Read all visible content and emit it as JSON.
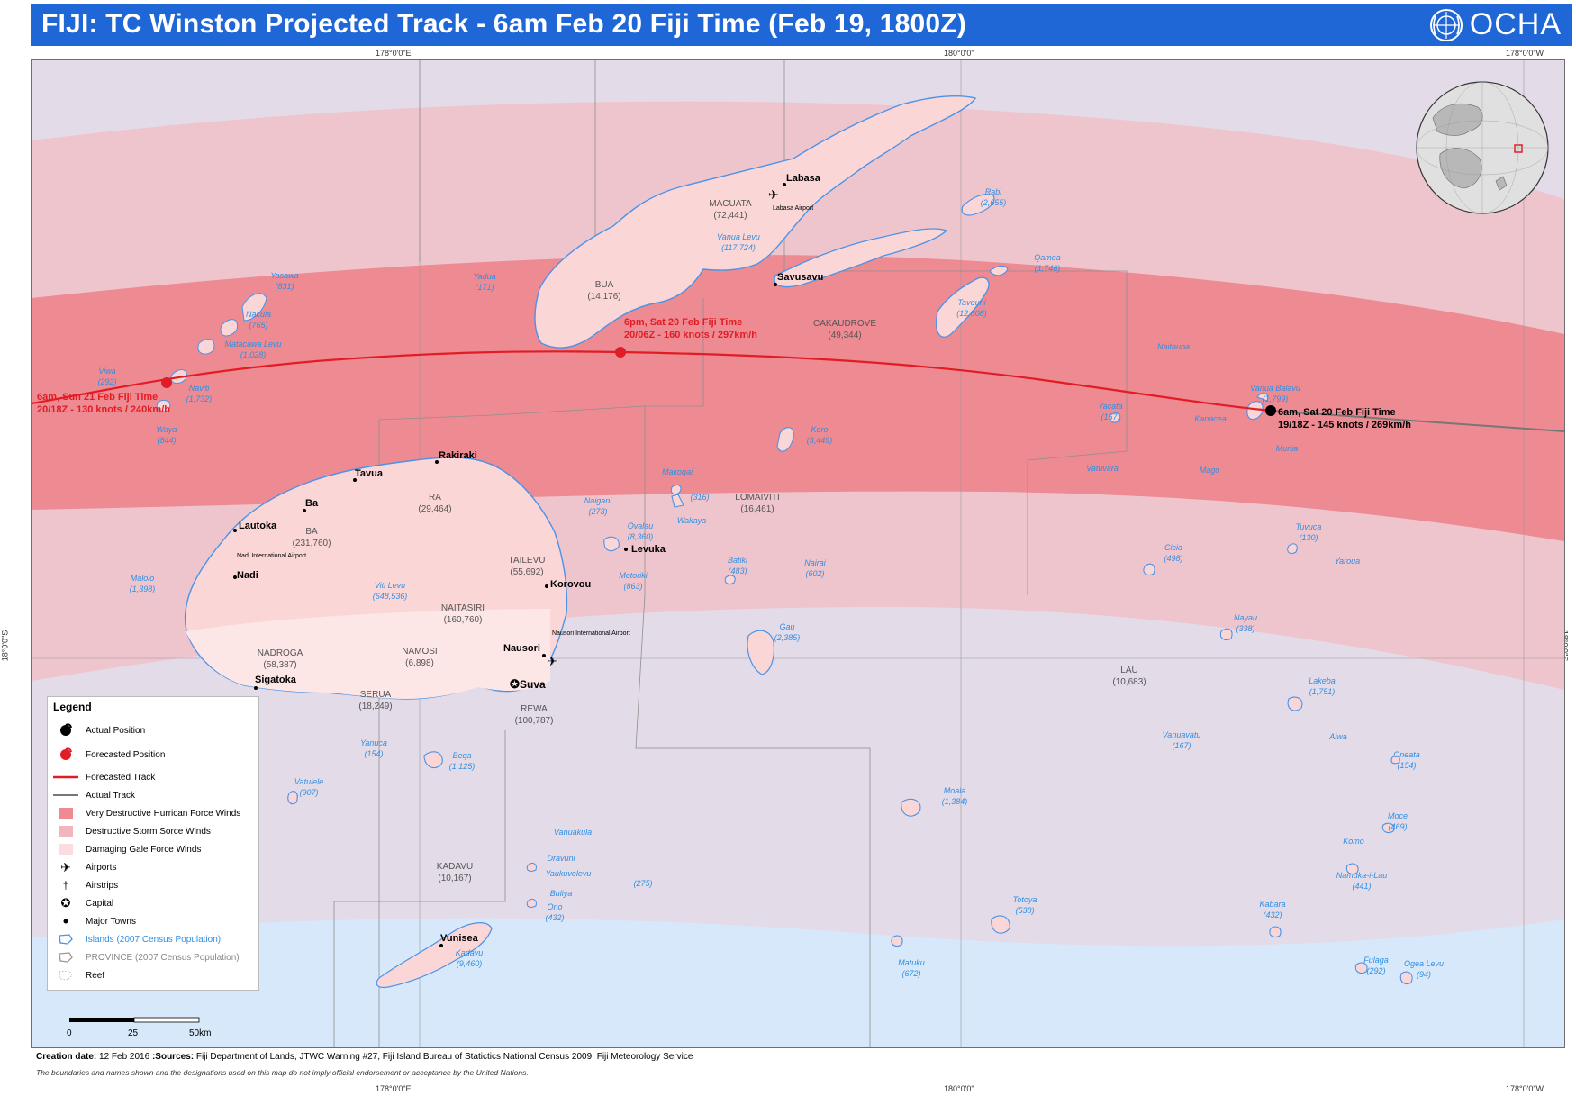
{
  "title": "FIJI: TC Winston Projected Track - 6am Feb 20 Fiji Time (Feb 19, 1800Z)",
  "brand": {
    "name": "OCHA",
    "color": "#1f66d6",
    "icon": "un-emblem-icon"
  },
  "coordinates": {
    "top": [
      "178°0'0\"E",
      "180°0'0\"",
      "178°0'0\"W"
    ],
    "bottom": [
      "178°0'0\"E",
      "180°0'0\"",
      "178°0'0\"W"
    ],
    "left": "18°0'0\"S",
    "right": "18°0'0\"S"
  },
  "track_points": [
    {
      "time": "6am, Sat 20 Feb Fiji Time",
      "detail": "19/18Z - 145 knots / 269km/h",
      "type": "actual"
    },
    {
      "time": "6pm, Sat 20 Feb Fiji Time",
      "detail": "20/06Z - 160 knots / 297km/h",
      "type": "forecast"
    },
    {
      "time": "6am, Sun 21 Feb Fiji Time",
      "detail": "20/18Z - 130 knots / 240km/h",
      "type": "forecast"
    }
  ],
  "provinces": [
    {
      "name": "MACUATA",
      "pop": "(72,441)"
    },
    {
      "name": "BUA",
      "pop": "(14,176)"
    },
    {
      "name": "CAKAUDROVE",
      "pop": "(49,344)"
    },
    {
      "name": "RA",
      "pop": "(29,464)"
    },
    {
      "name": "BA",
      "pop": "(231,760)"
    },
    {
      "name": "LOMAIVITI",
      "pop": "(16,461)"
    },
    {
      "name": "TAILEVU",
      "pop": "(55,692)"
    },
    {
      "name": "NAITASIRI",
      "pop": "(160,760)"
    },
    {
      "name": "NADROGA",
      "pop": "(58,387)"
    },
    {
      "name": "NAMOSI",
      "pop": "(6,898)"
    },
    {
      "name": "SERUA",
      "pop": "(18,249)"
    },
    {
      "name": "REWA",
      "pop": "(100,787)"
    },
    {
      "name": "LAU",
      "pop": "(10,683)"
    },
    {
      "name": "KADAVU",
      "pop": "(10,167)"
    }
  ],
  "towns": [
    "Labasa",
    "Savusavu",
    "Rakiraki",
    "Tavua",
    "Ba",
    "Lautoka",
    "Nadi",
    "Sigatoka",
    "Korovou",
    "Levuka",
    "Nausori",
    "Suva",
    "Vunisea"
  ],
  "airports": [
    "Labasa Airport",
    "Nadi International Airport",
    "Nausori International Airport"
  ],
  "islands": [
    {
      "name": "Rabi",
      "pop": "(2,655)"
    },
    {
      "name": "Qamea",
      "pop": "(1,746)"
    },
    {
      "name": "Taveuni",
      "pop": "(12,808)"
    },
    {
      "name": "Vanua Levu",
      "pop": "(117,724)"
    },
    {
      "name": "Yadua",
      "pop": "(171)"
    },
    {
      "name": "Yasawa",
      "pop": "(831)"
    },
    {
      "name": "Nacula",
      "pop": "(765)"
    },
    {
      "name": "Matacawa Levu",
      "pop": "(1,028)"
    },
    {
      "name": "Viwa",
      "pop": "(292)"
    },
    {
      "name": "Naviti",
      "pop": "(1,732)"
    },
    {
      "name": "Waya",
      "pop": "(844)"
    },
    {
      "name": "Malolo",
      "pop": "(1,398)"
    },
    {
      "name": "Naitauba",
      "pop": ""
    },
    {
      "name": "Vanua Balavu",
      "pop": "(1,799)"
    },
    {
      "name": "Yacata",
      "pop": "(157)"
    },
    {
      "name": "Kanacea",
      "pop": ""
    },
    {
      "name": "Munia",
      "pop": ""
    },
    {
      "name": "Vatuvara",
      "pop": ""
    },
    {
      "name": "Mago",
      "pop": ""
    },
    {
      "name": "Koro",
      "pop": "(3,449)"
    },
    {
      "name": "Makogai",
      "pop": ""
    },
    {
      "name": "",
      "pop": "(316)"
    },
    {
      "name": "Naigani",
      "pop": "(273)"
    },
    {
      "name": "Wakaya",
      "pop": ""
    },
    {
      "name": "Ovalau",
      "pop": "(8,360)"
    },
    {
      "name": "Motoriki",
      "pop": "(863)"
    },
    {
      "name": "Batiki",
      "pop": "(483)"
    },
    {
      "name": "Nairai",
      "pop": "(602)"
    },
    {
      "name": "Viti Levu",
      "pop": "(648,536)"
    },
    {
      "name": "Tuvuca",
      "pop": "(130)"
    },
    {
      "name": "Yaroua",
      "pop": ""
    },
    {
      "name": "Cicia",
      "pop": "(498)"
    },
    {
      "name": "Nayau",
      "pop": "(338)"
    },
    {
      "name": "Gau",
      "pop": "(2,385)"
    },
    {
      "name": "Lakeba",
      "pop": "(1,751)"
    },
    {
      "name": "Aiwa",
      "pop": ""
    },
    {
      "name": "Vanuavatu",
      "pop": "(167)"
    },
    {
      "name": "Oneata",
      "pop": "(154)"
    },
    {
      "name": "Yanuca",
      "pop": "(154)"
    },
    {
      "name": "Beqa",
      "pop": "(1,125)"
    },
    {
      "name": "Vatulele",
      "pop": "(907)"
    },
    {
      "name": "Moala",
      "pop": "(1,384)"
    },
    {
      "name": "Moce",
      "pop": "(469)"
    },
    {
      "name": "Komo",
      "pop": ""
    },
    {
      "name": "Vanuakula",
      "pop": ""
    },
    {
      "name": "Dravuni",
      "pop": ""
    },
    {
      "name": "Yaukuvelevu",
      "pop": ""
    },
    {
      "name": "",
      "pop": "(275)"
    },
    {
      "name": "Buliya",
      "pop": ""
    },
    {
      "name": "Ono",
      "pop": "(432)"
    },
    {
      "name": "Namuka-i-Lau",
      "pop": "(441)"
    },
    {
      "name": "Totoya",
      "pop": "(538)"
    },
    {
      "name": "Kabara",
      "pop": "(432)"
    },
    {
      "name": "Kadavu",
      "pop": "(9,460)"
    },
    {
      "name": "Matuku",
      "pop": "(672)"
    },
    {
      "name": "Fulaga",
      "pop": "(292)"
    },
    {
      "name": "Ogea Levu",
      "pop": "(94)"
    }
  ],
  "legend": {
    "title": "Legend",
    "items": [
      {
        "label": "Actual Position",
        "icon": "cyclone-black-icon"
      },
      {
        "label": "Forecasted Position",
        "icon": "cyclone-red-icon"
      },
      {
        "label": "Forecasted Track",
        "icon": "red-line-icon"
      },
      {
        "label": "Actual Track",
        "icon": "grey-line-icon"
      },
      {
        "label": "Very Destructive Hurrican Force Winds",
        "icon": "swatch-dark-icon"
      },
      {
        "label": "Destructive Storm Sorce Winds",
        "icon": "swatch-mid-icon"
      },
      {
        "label": "Damaging Gale Force Winds",
        "icon": "swatch-light-icon"
      },
      {
        "label": "Airports",
        "icon": "airport-icon"
      },
      {
        "label": "Airstrips",
        "icon": "airstrip-icon"
      },
      {
        "label": "Capital",
        "icon": "capital-icon"
      },
      {
        "label": "Major Towns",
        "icon": "town-dot-icon"
      },
      {
        "label": "Islands (2007 Census Population)",
        "icon": "island-outline-icon"
      },
      {
        "label": "PROVINCE (2007 Census Population)",
        "icon": "province-outline-icon"
      },
      {
        "label": "Reef",
        "icon": "reef-icon"
      }
    ]
  },
  "scale": {
    "labels": [
      "0",
      "25",
      "50km"
    ]
  },
  "footer": {
    "creation_label": "Creation date:",
    "creation_date": "12 Feb 2016",
    "sources_label": ":Sources:",
    "sources": "Fiji Department of Lands, JTWC Warning #27, Fiji Island Bureau of Statictics National Census 2009, Fiji Meteorology Service",
    "disclaimer": "The boundaries and names shown and the designations used on this map do not imply official endorsement or acceptance by the United Nations."
  },
  "colors": {
    "sea": "#e3dbe8",
    "gale": "#eec6ce",
    "storm": "#ee8890",
    "south_sea": "#d6e8fa",
    "forecast_track": "#e21c24",
    "actual_track": "#777777",
    "island_label": "#2f8fe3",
    "land": "#fbd6d6"
  }
}
